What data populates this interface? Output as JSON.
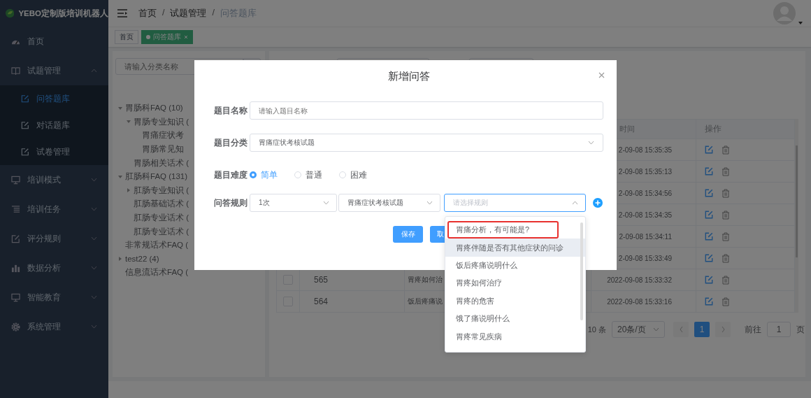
{
  "sidebar": {
    "logo_text": "YEBO定制版培训机器人",
    "items": [
      {
        "label": "首页"
      },
      {
        "label": "试题管理",
        "expanded": true,
        "children": [
          {
            "label": "问答题库",
            "selected": true
          },
          {
            "label": "对话题库",
            "selected": false
          },
          {
            "label": "试卷管理",
            "selected": false
          }
        ]
      },
      {
        "label": "培训模式",
        "expanded": false
      },
      {
        "label": "培训任务",
        "expanded": false
      },
      {
        "label": "评分规则",
        "expanded": false
      },
      {
        "label": "数据分析",
        "expanded": false
      },
      {
        "label": "智能教育",
        "expanded": false
      },
      {
        "label": "系统管理",
        "expanded": false
      }
    ]
  },
  "breadcrumb": {
    "items": [
      "首页",
      "试题管理",
      "问答题库"
    ],
    "separator": "/"
  },
  "tags": [
    {
      "label": "首页",
      "selected": false
    },
    {
      "label": "问答题库",
      "selected": true
    }
  ],
  "tree_search": {
    "placeholder": "请输入分类名称"
  },
  "tree": [
    {
      "label": "胃肠科FAQ (10)",
      "expanded": true,
      "children": [
        {
          "label": "胃肠专业知识 (",
          "expanded": true,
          "children": [
            {
              "label": "胃痛症状考"
            },
            {
              "label": "胃肠常见知"
            }
          ]
        },
        {
          "label": "胃肠相关话术 ("
        }
      ]
    },
    {
      "label": "肛肠科FAQ (131)",
      "expanded": true,
      "children": [
        {
          "label": "肛肠专业知识 (",
          "expanded": false
        },
        {
          "label": "肛肠基础话术 ("
        },
        {
          "label": "肛肠专业话术 ("
        },
        {
          "label": "肛肠专业话术 ("
        }
      ]
    },
    {
      "label": "非常规话术FAQ ("
    },
    {
      "label": "test22 (4)",
      "expanded": false
    },
    {
      "label": "信息流话术FAQ ("
    }
  ],
  "table": {
    "columns": [
      "时间",
      "操作"
    ],
    "rows": [
      {
        "time": "2-09-08 15:35:35"
      },
      {
        "time": "2-09-08 15:35:13"
      },
      {
        "time": "2-09-08 15:34:56"
      },
      {
        "time": "2-09-08 15:34:35"
      },
      {
        "time": "2-09-08 15:34:11"
      },
      {
        "time": "2-09-08 15:33:49"
      },
      {
        "id": "565",
        "name": "胃疼如何治",
        "time": "2022-09-08 15:33:32",
        "checked": false
      },
      {
        "id": "564",
        "name": "饭后疼痛说",
        "time": "2022-09-08 15:33:16",
        "checked": false
      }
    ]
  },
  "pagination": {
    "total": "10 条",
    "page_size": "20条/页",
    "pages": [
      {
        "label": "1",
        "selected": true
      }
    ],
    "goto_label": "前往",
    "goto_value": "1",
    "page_suffix": "页"
  },
  "dialog": {
    "title": "新增问答",
    "fields": [
      {
        "kind": "input",
        "label": "题目名称",
        "placeholder": "请输入题目名称"
      },
      {
        "kind": "select",
        "label": "题目分类",
        "value": "胃痛症状考核试题"
      },
      {
        "kind": "radio",
        "label": "题目难度",
        "options": [
          {
            "label": "简单",
            "selected": true
          },
          {
            "label": "普通",
            "selected": false
          },
          {
            "label": "困难",
            "selected": false
          }
        ]
      },
      {
        "kind": "rule",
        "label": "问答规则",
        "selects": [
          {
            "value": "1次",
            "open": false
          },
          {
            "value": "胃痛症状考核试题",
            "open": false
          },
          {
            "placeholder": "请选择规则",
            "open": true
          }
        ]
      }
    ],
    "buttons": [
      "保存",
      "取"
    ]
  },
  "dropdown": {
    "options": [
      {
        "label": "胃痛分析，有可能是?",
        "hovered": false,
        "boxed": true
      },
      {
        "label": "胃疼伴随是否有其他症状的问诊",
        "hovered": true,
        "boxed": false
      },
      {
        "label": "饭后疼痛说明什么",
        "hovered": false,
        "boxed": false
      },
      {
        "label": "胃疼如何治疗",
        "hovered": false,
        "boxed": false
      },
      {
        "label": "胃疼的危害",
        "hovered": false,
        "boxed": false
      },
      {
        "label": "饿了痛说明什么",
        "hovered": false,
        "boxed": false
      },
      {
        "label": "胃疼常见疾病",
        "hovered": false,
        "boxed": false
      }
    ]
  }
}
